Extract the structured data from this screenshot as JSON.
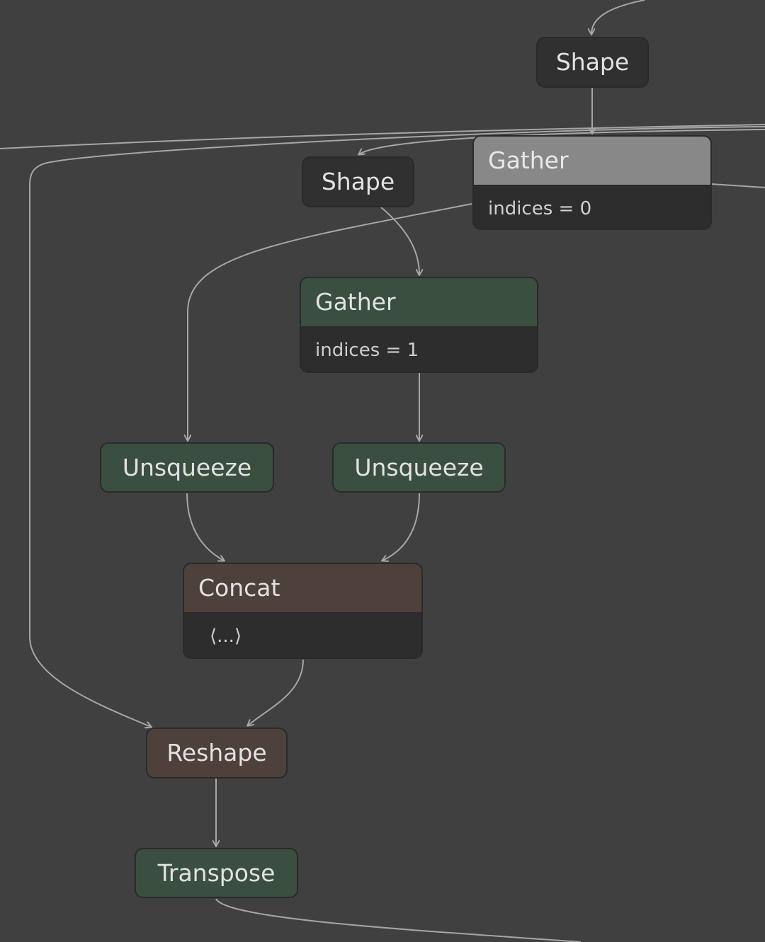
{
  "colors": {
    "background": "#404040",
    "edge": "#a6a6a6",
    "node_dark": "#303030",
    "node_gray": "#888888",
    "node_green": "#3b4f41",
    "node_brown": "#4e403b",
    "attr_bg": "#2d2d2d"
  },
  "nodes": [
    {
      "id": "shape-top",
      "title": "Shape"
    },
    {
      "id": "gather-0",
      "title": "Gather",
      "attr": "indices = 0"
    },
    {
      "id": "shape-mid",
      "title": "Shape"
    },
    {
      "id": "gather-1",
      "title": "Gather",
      "attr": "indices = 1"
    },
    {
      "id": "unsqueeze-left",
      "title": "Unsqueeze"
    },
    {
      "id": "unsqueeze-right",
      "title": "Unsqueeze"
    },
    {
      "id": "concat",
      "title": "Concat",
      "attr": "⟨...⟩"
    },
    {
      "id": "reshape",
      "title": "Reshape"
    },
    {
      "id": "transpose",
      "title": "Transpose"
    }
  ]
}
